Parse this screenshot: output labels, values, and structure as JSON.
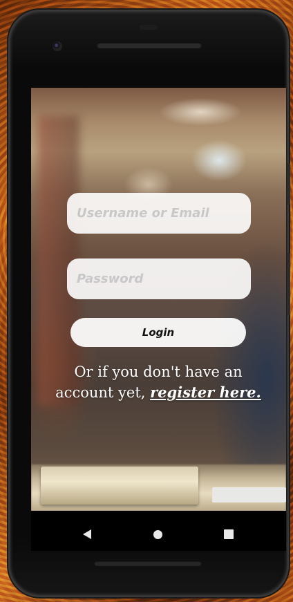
{
  "login_form": {
    "username_placeholder": "Username or Email",
    "password_placeholder": "Password",
    "login_label": "Login"
  },
  "register_prompt": {
    "text": "Or if you don't have an account yet, ",
    "link_label": "register here."
  },
  "nav_bar": {
    "back_icon": "back-triangle-icon",
    "home_icon": "home-circle-icon",
    "recents_icon": "recents-square-icon"
  },
  "colors": {
    "field_background": "#ffffff",
    "placeholder_text": "#c8c8c8",
    "button_text": "#111111",
    "prompt_text": "#ffffff"
  }
}
